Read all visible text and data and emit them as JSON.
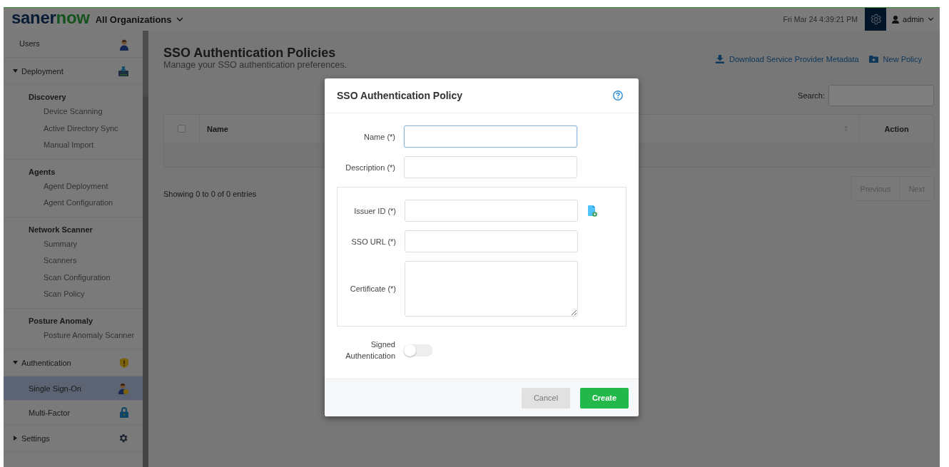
{
  "topbar": {
    "logo_parts": [
      "saner",
      "now"
    ],
    "organization_selector": "All Organizations",
    "datetime": "Fri Mar 24  4:39:21 PM",
    "user": "admin"
  },
  "sidebar": {
    "items": [
      {
        "kind": "link",
        "label": "Users",
        "selected": false
      },
      {
        "kind": "section",
        "label": "Deployment",
        "expanded": true,
        "children": [
          {
            "kind": "group",
            "label": "Discovery",
            "children": [
              {
                "label": "Device Scanning",
                "selected": false
              },
              {
                "label": "Active Directory Sync",
                "selected": false
              },
              {
                "label": "Manual Import",
                "selected": false
              }
            ]
          },
          {
            "kind": "group",
            "label": "Agents",
            "children": [
              {
                "label": "Agent Deployment",
                "selected": false
              },
              {
                "label": "Agent Configuration",
                "selected": false
              }
            ]
          },
          {
            "kind": "group",
            "label": "Network Scanner",
            "children": [
              {
                "label": "Summary",
                "selected": false
              },
              {
                "label": "Scanners",
                "selected": false
              },
              {
                "label": "Scan Configuration",
                "selected": false
              },
              {
                "label": "Scan Policy",
                "selected": false
              }
            ]
          },
          {
            "kind": "group",
            "label": "Posture Anomaly",
            "children": [
              {
                "label": "Posture Anomaly Scanner",
                "selected": false
              }
            ]
          }
        ]
      },
      {
        "kind": "section",
        "label": "Authentication",
        "expanded": true,
        "children": [
          {
            "kind": "link",
            "label": "Single Sign-On",
            "selected": true
          },
          {
            "kind": "link",
            "label": "Multi-Factor",
            "selected": false
          }
        ]
      },
      {
        "kind": "section",
        "label": "Settings",
        "expanded": false
      }
    ]
  },
  "page": {
    "title": "SSO Authentication Policies",
    "subtitle": "Manage your SSO authentication preferences.",
    "actions": [
      {
        "kind": "download",
        "label": "Download Service Provider Metadata"
      },
      {
        "kind": "folder",
        "label": "New Policy"
      }
    ],
    "search": {
      "label": "Search:"
    },
    "table": {
      "columns": [
        {
          "kind": "checkbox",
          "checked": false
        },
        {
          "kind": "text",
          "label": "Name",
          "sortable": true
        },
        {
          "kind": "text",
          "label": "Action",
          "sortable": false
        }
      ]
    },
    "info": "Showing 0 to 0 of 0 entries",
    "pagination": [
      {
        "label": "Previous",
        "disabled": true
      },
      {
        "label": "Next",
        "disabled": true
      }
    ]
  },
  "modal": {
    "title": "SSO Authentication Policy",
    "fields": [
      {
        "kind": "input",
        "label": "Name (*)",
        "focused": true
      },
      {
        "kind": "input",
        "label": "Description (*)",
        "focused": false
      }
    ],
    "identity_provider": {
      "fields": [
        {
          "kind": "input",
          "label": "Issuer ID (*)",
          "focused": false,
          "upload": true
        },
        {
          "kind": "input",
          "label": "SSO URL (*)",
          "focused": false,
          "upload": false
        },
        {
          "kind": "textarea",
          "label": "Certificate (*)",
          "focused": false,
          "upload": false
        }
      ]
    },
    "signed_authentication": {
      "label": "Signed Authentication",
      "on": false
    },
    "buttons": [
      {
        "kind": "secondary",
        "label": "Cancel"
      },
      {
        "kind": "primary",
        "label": "Create"
      }
    ]
  }
}
